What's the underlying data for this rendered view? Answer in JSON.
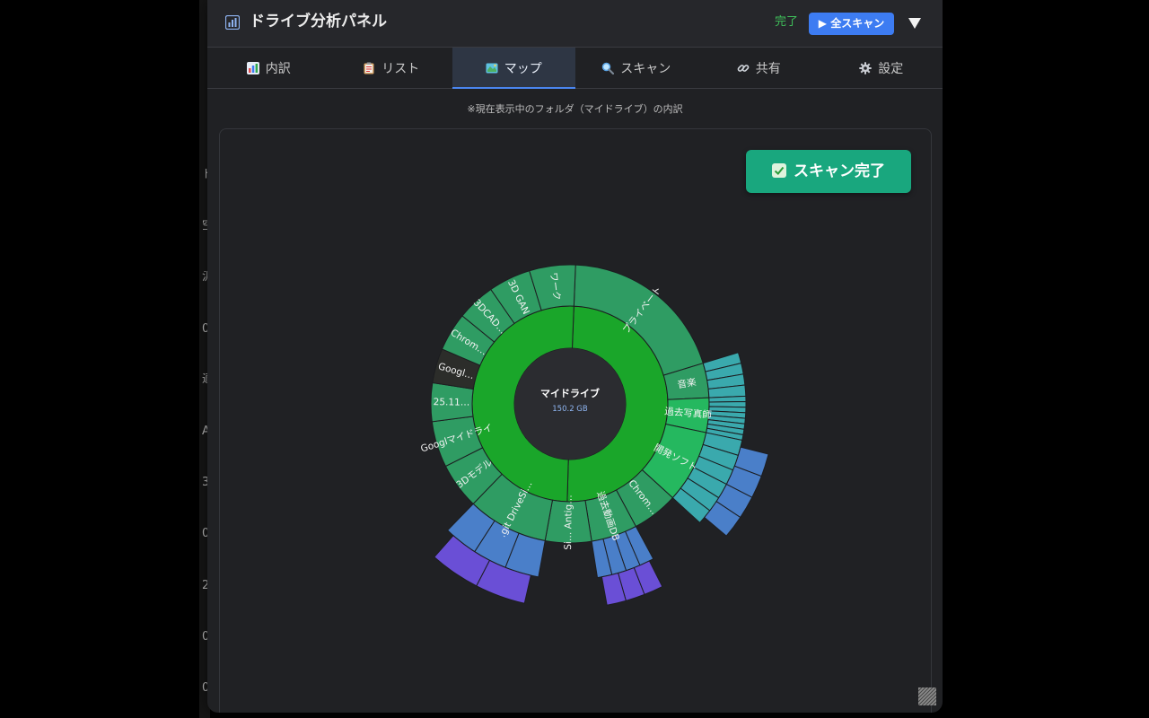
{
  "backdrop": {
    "glyphs": [
      "ド",
      "空",
      "汎",
      "0",
      "適",
      "A",
      "3",
      "0",
      "2",
      "0",
      "0"
    ]
  },
  "header": {
    "title": "ドライブ分析パネル",
    "status": "完了",
    "scan_all_label": "▶ 全スキャン",
    "icon": "bar-chart-icon",
    "toggle_icon": "triangle-down-icon"
  },
  "tabs": [
    {
      "label": "内訳",
      "icon": "bar-chart-icon",
      "active": false
    },
    {
      "label": "リスト",
      "icon": "clipboard-icon",
      "active": false
    },
    {
      "label": "マップ",
      "icon": "map-icon",
      "active": true
    },
    {
      "label": "スキャン",
      "icon": "magnifier-icon",
      "active": false
    },
    {
      "label": "共有",
      "icon": "link-icon",
      "active": false
    },
    {
      "label": "設定",
      "icon": "gear-icon",
      "active": false
    }
  ],
  "caption": "※現在表示中のフォルダ（マイドライブ）の内訳",
  "scan_done_label": "スキャン完了",
  "sunburst": {
    "root_name": "マイドライブ",
    "root_size": "150.2 GB",
    "folders": [
      {
        "label": "プライベート",
        "start": 0.0,
        "end": 2.2,
        "depth": 3,
        "hue": 1,
        "leaves": 14
      },
      {
        "label": "音楽",
        "start": 2.2,
        "end": 2.65,
        "depth": 4,
        "hue": 1,
        "leaves": 8
      },
      {
        "label": "過去写真師",
        "start": 2.65,
        "end": 3.1,
        "depth": 4,
        "hue": 2,
        "leaves": 16
      },
      {
        "label": "開発ソフト",
        "start": 3.1,
        "end": 4.05,
        "depth": 5,
        "hue": 2,
        "leaves": 12
      },
      {
        "label": "Chrom…",
        "start": 4.05,
        "end": 4.65,
        "depth": 2,
        "hue": 0,
        "leaves": 0
      },
      {
        "label": "過去動画DB",
        "start": 4.65,
        "end": 5.25,
        "depth": 5,
        "hue": 3,
        "leaves": 8
      },
      {
        "label": "Si… Antig…",
        "start": 5.25,
        "end": 5.85,
        "depth": 3,
        "hue": 1,
        "leaves": 4
      },
      {
        "label": ".git DriveSi…",
        "start": 5.85,
        "end": 6.9,
        "depth": 5,
        "hue": 3,
        "leaves": 6
      },
      {
        "label": "3Dモデル",
        "start": 6.9,
        "end": 7.5,
        "depth": 2,
        "hue": 0,
        "leaves": 0
      },
      {
        "label": "Googlマイドライ",
        "start": 7.5,
        "end": 8.1,
        "depth": 2,
        "hue": 0,
        "leaves": 0
      },
      {
        "label": "25.11…",
        "start": 8.1,
        "end": 8.6,
        "depth": 2,
        "hue": 0,
        "leaves": 0
      },
      {
        "label": "Googl…",
        "start": 8.6,
        "end": 9.05,
        "depth": 2,
        "hue": 4,
        "leaves": 0
      },
      {
        "label": "Chrom…",
        "start": 9.05,
        "end": 9.55,
        "depth": 2,
        "hue": 0,
        "leaves": 0
      },
      {
        "label": "3DCAD…",
        "start": 9.55,
        "end": 10.05,
        "depth": 3,
        "hue": 1,
        "leaves": 3
      },
      {
        "label": "3D GAN",
        "start": 10.05,
        "end": 10.6,
        "depth": 2,
        "hue": 0,
        "leaves": 0
      },
      {
        "label": "ワーク",
        "start": 10.6,
        "end": 11.2,
        "depth": 2,
        "hue": 0,
        "leaves": 0
      }
    ]
  },
  "colors": {
    "panel_bg": "#202124",
    "inner_ring": "#1aa62a",
    "level_green": "#2f9c63",
    "level_teal": "#3aa9ad",
    "level_blue": "#4a7fc9",
    "level_purple": "#6a4fd6",
    "level_violet": "#a05ad8",
    "level_dark": "#4a4a40",
    "status_green": "#3fbf5a",
    "accent_blue": "#3d7cf2",
    "badge_green": "#19a77e"
  }
}
